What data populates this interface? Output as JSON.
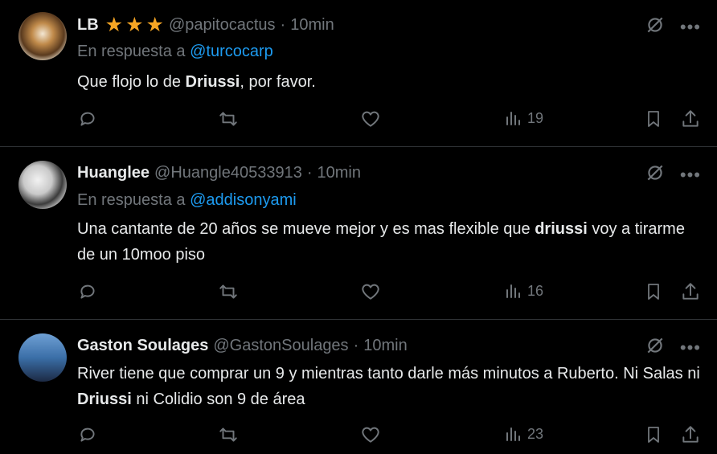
{
  "tweets": [
    {
      "name": "LB",
      "stars": 3,
      "handle": "@papitocactus",
      "time": "10min",
      "reply_prefix": "En respuesta a",
      "reply_mention": "@turcocarp",
      "text_parts": [
        {
          "t": "Que flojo lo de ",
          "b": false
        },
        {
          "t": "Driussi",
          "b": true
        },
        {
          "t": ", por favor.",
          "b": false
        }
      ],
      "views": "19"
    },
    {
      "name": "Huanglee",
      "handle": "@Huangle40533913",
      "time": "10min",
      "reply_prefix": "En respuesta a",
      "reply_mention": "@addisonyami",
      "text_parts": [
        {
          "t": "Una cantante de 20 años se mueve mejor  y es mas flexible que ",
          "b": false
        },
        {
          "t": "driussi",
          "b": true
        },
        {
          "t": " voy a tirarme de un 10moo piso",
          "b": false
        }
      ],
      "views": "16"
    },
    {
      "name": "Gaston Soulages",
      "handle": "@GastonSoulages",
      "time": "10min",
      "text_parts": [
        {
          "t": "River tiene que comprar un 9 y mientras tanto darle más minutos a Ruberto. Ni Salas ni ",
          "b": false
        },
        {
          "t": "Driussi",
          "b": true
        },
        {
          "t": " ni Colidio son 9 de área",
          "b": false
        }
      ],
      "views": "23"
    }
  ],
  "colors": {
    "background": "#000000",
    "text": "#e7e9ea",
    "muted": "#71767b",
    "mention": "#1d9bf0",
    "star": "#f5a524",
    "divider": "#2f3336"
  },
  "icons": {
    "grok": "grok-icon",
    "more": "more-icon",
    "reply": "reply-icon",
    "retweet": "retweet-icon",
    "like": "like-icon",
    "views": "views-icon",
    "bookmark": "bookmark-icon",
    "share": "share-icon"
  }
}
